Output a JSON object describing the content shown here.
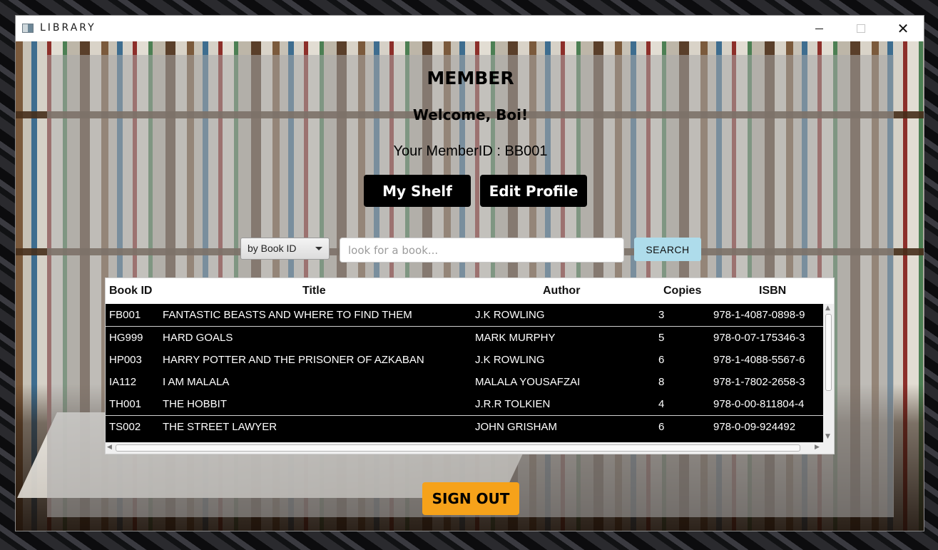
{
  "window": {
    "title": "LIBRARY",
    "controls": {
      "minimize": "minimize-icon",
      "maximize": "maximize-icon",
      "close": "✕"
    }
  },
  "header": {
    "title": "MEMBER",
    "welcome": "Welcome, Boi!",
    "member_id": "Your MemberID : BB001"
  },
  "actions": {
    "my_shelf": "My Shelf",
    "edit_profile": "Edit Profile",
    "sign_out": "SIGN OUT"
  },
  "search": {
    "filter_selected": "by Book ID",
    "placeholder": "look for a book...",
    "value": "",
    "button": "SEARCH"
  },
  "table": {
    "columns": [
      "Book ID",
      "Title",
      "Author",
      "Copies",
      "ISBN"
    ],
    "rows": [
      [
        "FB001",
        "FANTASTIC BEASTS AND WHERE TO FIND THEM",
        "J.K ROWLING",
        "3",
        "978-1-4087-0898-9"
      ],
      [
        "HG999",
        "HARD GOALS",
        "MARK MURPHY",
        "5",
        "978-0-07-175346-3"
      ],
      [
        "HP003",
        "HARRY POTTER AND THE PRISONER OF AZKABAN",
        "J.K ROWLING",
        "6",
        "978-1-4088-5567-6"
      ],
      [
        "IA112",
        "I AM MALALA",
        "MALALA YOUSAFZAI",
        "8",
        "978-1-7802-2658-3"
      ],
      [
        "TH001",
        "THE HOBBIT",
        "J.R.R TOLKIEN",
        "4",
        "978-0-00-811804-4"
      ],
      [
        "TS002",
        "THE STREET LAWYER",
        "JOHN GRISHAM",
        "6",
        "978-0-09-924492"
      ]
    ]
  },
  "colors": {
    "search_button": "#aedceb",
    "sign_out_button": "#f6a21a",
    "primary_button": "#000000"
  }
}
